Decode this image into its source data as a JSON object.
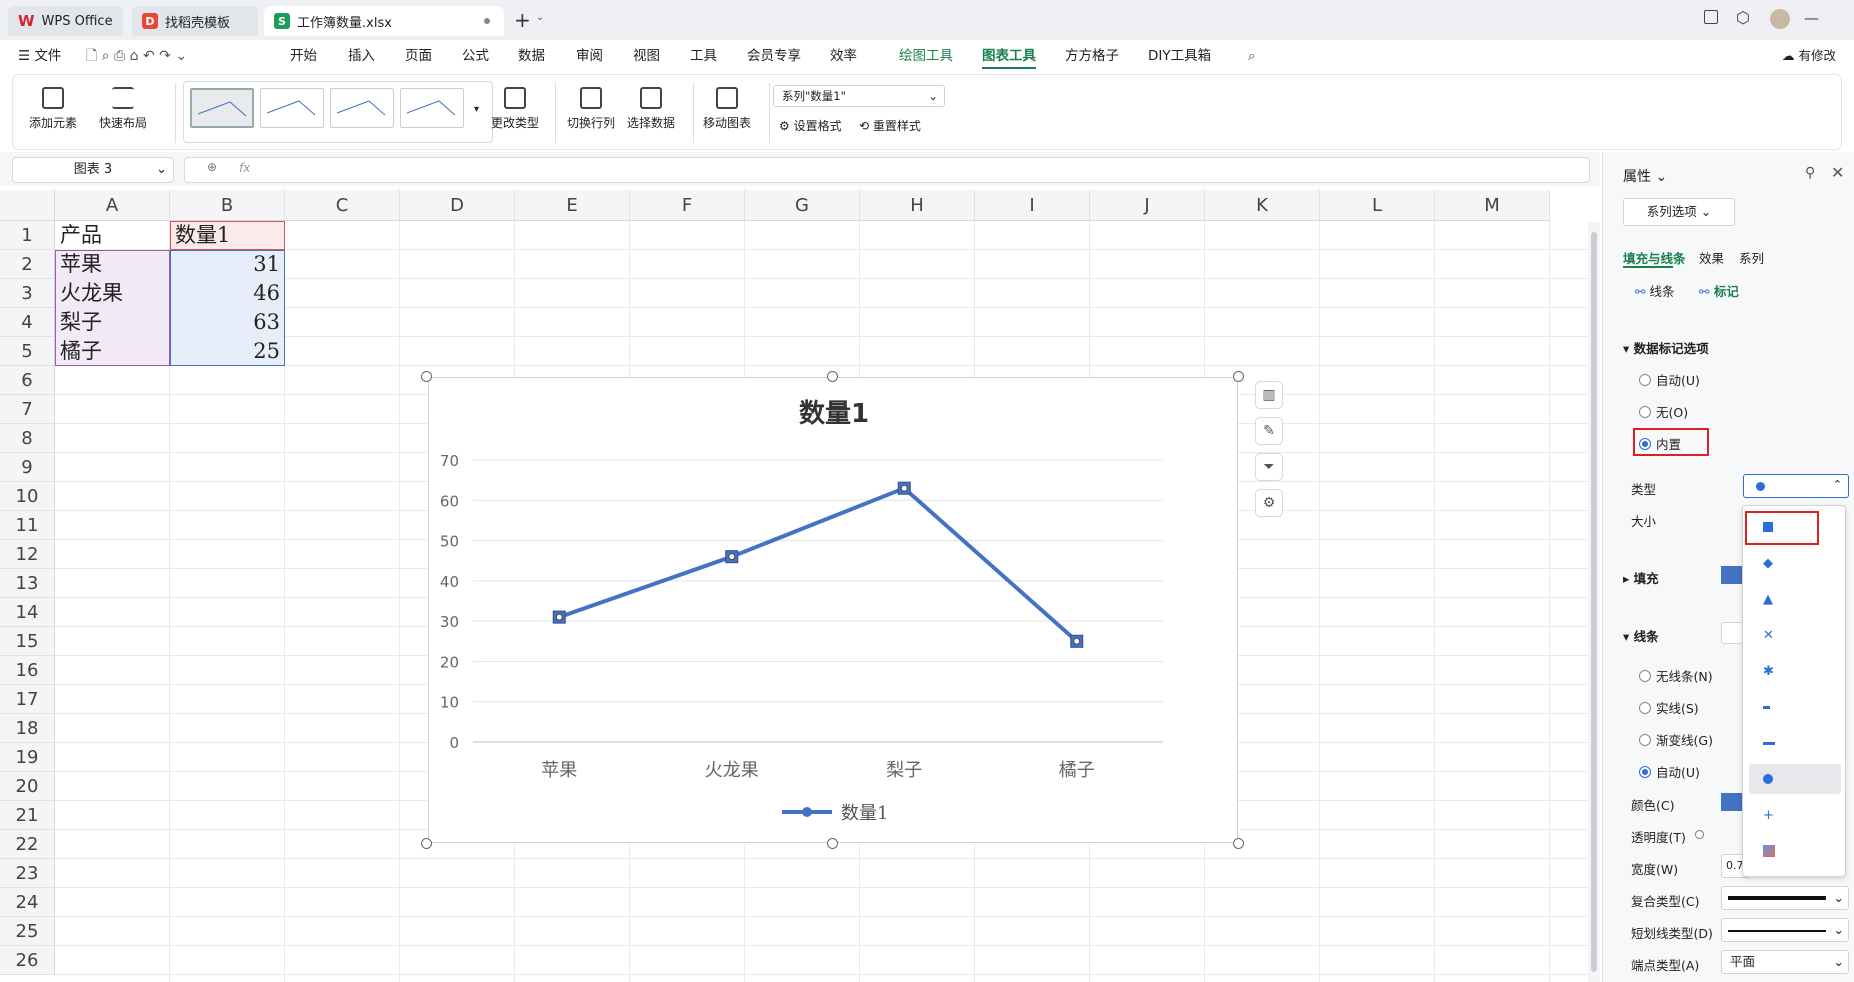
{
  "window_tabs": [
    {
      "label": "WPS Office",
      "icon": "wps-logo-icon"
    },
    {
      "label": "找稻壳模板",
      "icon": "docer-icon"
    },
    {
      "label": "工作簿数量.xlsx",
      "icon": "spreadsheet-icon"
    }
  ],
  "menu": {
    "file": "文件",
    "items": [
      "开始",
      "插入",
      "页面",
      "公式",
      "数据",
      "审阅",
      "视图",
      "工具",
      "会员专享",
      "效率",
      "绘图工具",
      "图表工具",
      "方方格子",
      "DIY工具箱"
    ],
    "selected": "图表工具",
    "modified": "有修改"
  },
  "ribbon": {
    "add_element": "添加元素",
    "quick_layout": "快速布局",
    "change_type": "更改类型",
    "switch_rowcol": "切换行列",
    "select_data": "选择数据",
    "move_chart": "移动图表",
    "series_select": "系列\"数量1\"",
    "set_format": "设置格式",
    "reset_style": "重置样式"
  },
  "formula": {
    "name_box": "图表 3",
    "fx": "fx"
  },
  "sheet": {
    "columns": [
      "A",
      "B",
      "C",
      "D",
      "E",
      "F",
      "G",
      "H",
      "I",
      "J",
      "K",
      "L",
      "M"
    ],
    "rows": [
      "1",
      "2",
      "3",
      "4",
      "5",
      "6",
      "7",
      "8",
      "9",
      "10",
      "11",
      "12",
      "13",
      "14",
      "15",
      "16",
      "17",
      "18",
      "19",
      "20",
      "21",
      "22",
      "23",
      "24",
      "25",
      "26"
    ],
    "headers": [
      "产品",
      "数量1"
    ],
    "data": [
      {
        "product": "苹果",
        "qty": "31"
      },
      {
        "product": "火龙果",
        "qty": "46"
      },
      {
        "product": "梨子",
        "qty": "63"
      },
      {
        "product": "橘子",
        "qty": "25"
      }
    ]
  },
  "chart_data": {
    "type": "line",
    "title": "数量1",
    "categories": [
      "苹果",
      "火龙果",
      "梨子",
      "橘子"
    ],
    "series": [
      {
        "name": "数量1",
        "values": [
          31,
          46,
          63,
          25
        ],
        "color": "#4472c4"
      }
    ],
    "ylim": [
      0,
      70
    ],
    "yticks": [
      "0",
      "10",
      "20",
      "30",
      "40",
      "50",
      "60",
      "70"
    ],
    "grid": true,
    "legend_position": "bottom"
  },
  "panel": {
    "title": "属性",
    "series_options": "系列选项",
    "tabs": [
      "填充与线条",
      "效果",
      "系列"
    ],
    "subtabs": [
      "线条",
      "标记"
    ],
    "marker_section": "数据标记选项",
    "marker_radios": [
      "自动(U)",
      "无(O)",
      "内置"
    ],
    "type_label": "类型",
    "size_label": "大小",
    "fill_section": "填充",
    "line_section": "线条",
    "line_radios": [
      "无线条(N)",
      "实线(S)",
      "渐变线(G)",
      "自动(U)"
    ],
    "color_label": "颜色(C)",
    "transparency_label": "透明度(T)",
    "width_label": "宽度(W)",
    "width_value": "0.7",
    "compound_label": "复合类型(C)",
    "dash_label": "短划线类型(D)",
    "cap_label": "端点类型(A)",
    "cap_value": "平面",
    "accent": "#4472c4"
  },
  "marker_types": [
    "square",
    "diamond",
    "triangle",
    "x",
    "star",
    "short-dash",
    "long-dash",
    "circle",
    "plus",
    "picture"
  ]
}
